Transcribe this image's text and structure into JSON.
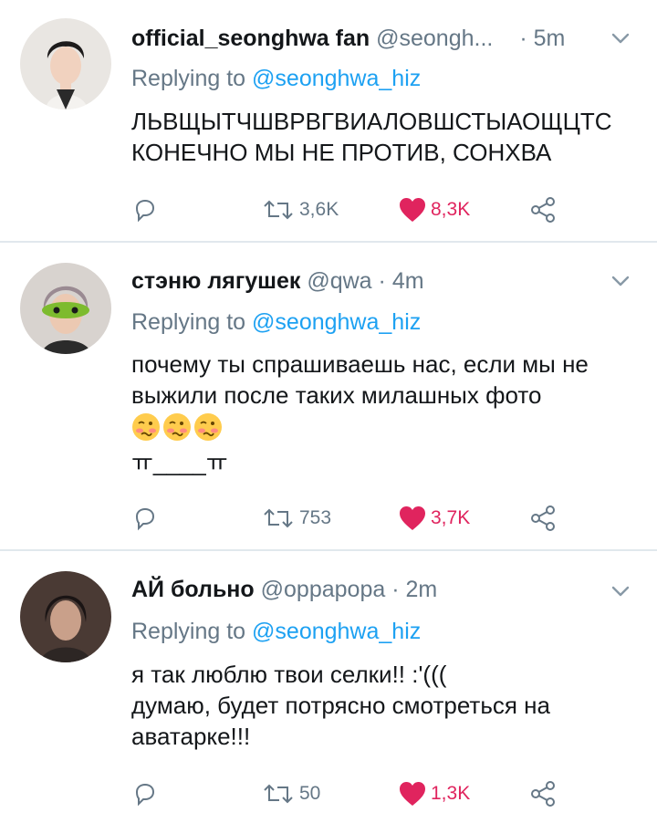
{
  "tweets": [
    {
      "name": "official_seonghwa fan",
      "handle": "@seongh...",
      "time": "· 5m",
      "replying_prefix": "Replying to ",
      "replying_handle": "@seonghwa_hiz",
      "text_lines": [
        "ЛЬВЩЫТЧШВРВГВИАЛОВШСТЫАОЩЦТС",
        "КОНЕЧНО МЫ НЕ ПРОТИВ, СОНХВА"
      ],
      "retweets": "3,6K",
      "likes": "8,3K"
    },
    {
      "name": "стэню лягушек",
      "handle": "@qwa",
      "time": "· 4m",
      "replying_prefix": "Replying to ",
      "replying_handle": "@seonghwa_hiz",
      "text_lines": [
        "почему ты спрашиваешь нас, если мы не",
        "выжили после таких милашных фото"
      ],
      "emoji_count": 3,
      "extra_line": "ㅠ____ㅠ",
      "retweets": "753",
      "likes": "3,7K"
    },
    {
      "name": "АЙ больно",
      "handle": "@оррарора",
      "time": "· 2m",
      "replying_prefix": "Replying to ",
      "replying_handle": "@seonghwa_hiz",
      "text_lines": [
        "я так люблю твои селки!! :'(((",
        "думаю, будет потрясно смотреться на",
        "аватарке!!!"
      ],
      "retweets": "50",
      "likes": "1,3K"
    }
  ],
  "colors": {
    "like": "#e0245e",
    "link": "#1da1f2",
    "muted": "#657786",
    "divider": "#e1e8ed"
  },
  "icons": [
    "reply-icon",
    "retweet-icon",
    "heart-icon",
    "share-icon",
    "chevron-down-icon",
    "woozy-face-emoji"
  ]
}
